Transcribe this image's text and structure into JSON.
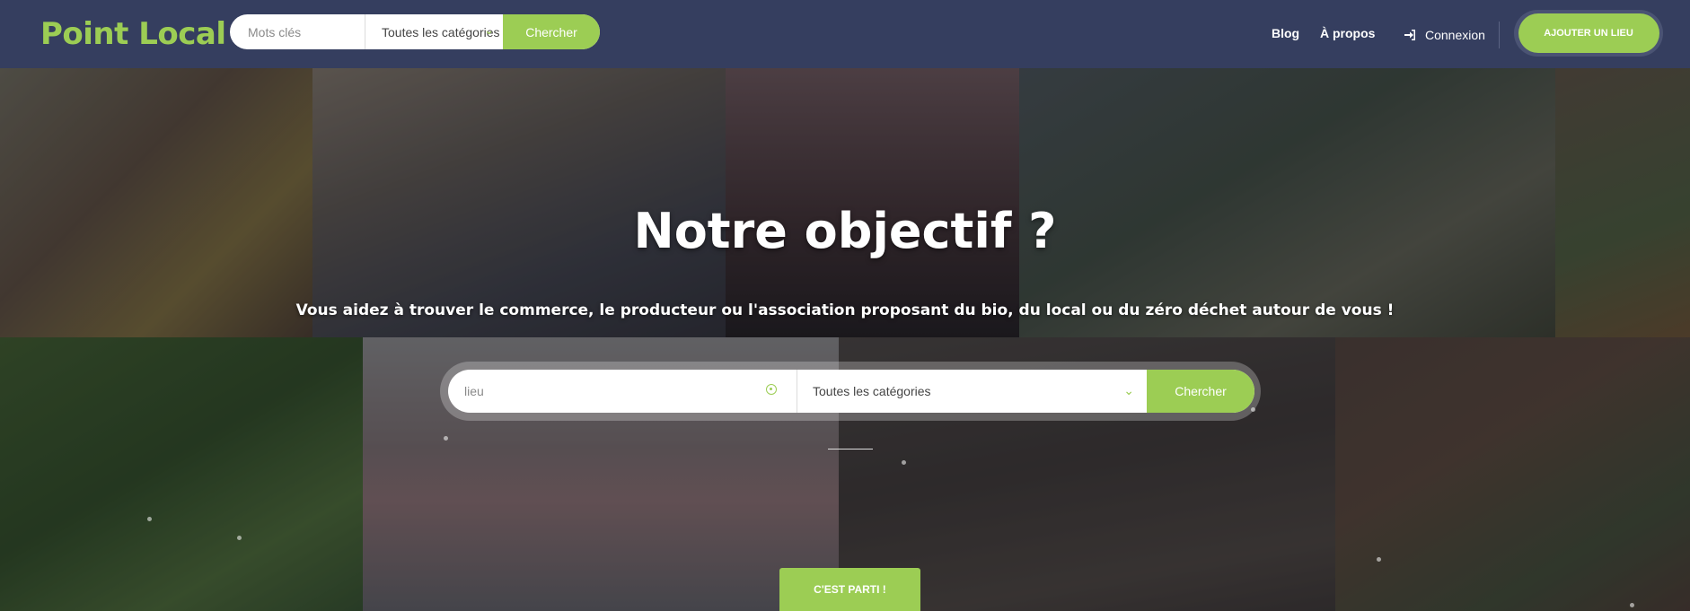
{
  "header": {
    "logo": "Point Local",
    "search": {
      "keywords_placeholder": "Mots clés",
      "category_selected": "Toutes les catégories",
      "search_button": "Chercher"
    },
    "nav": {
      "blog": "Blog",
      "about": "À propos",
      "login": "Connexion",
      "add_place": "AJOUTER UN LIEU"
    }
  },
  "hero": {
    "title": "Notre objectif ?",
    "subtitle": "Vous aidez à trouver le commerce, le producteur ou l'association proposant du bio, du local ou du zéro déchet autour de vous !",
    "search": {
      "location_placeholder": "lieu",
      "category_selected": "Toutes les catégories",
      "search_button": "Chercher"
    },
    "cta": "C'EST PARTI !"
  },
  "colors": {
    "header_bg": "#353e5f",
    "accent": "#9ccd54"
  },
  "icons": {
    "login": "sign-in-icon",
    "chevron": "chevron-down-icon",
    "geolocation": "crosshair-icon"
  }
}
